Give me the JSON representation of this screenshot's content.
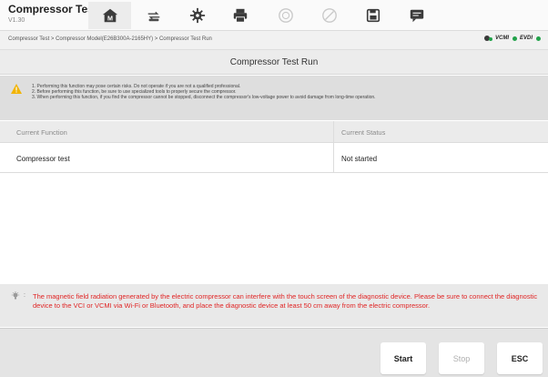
{
  "app": {
    "title": "Compressor Test",
    "version": "V1.30"
  },
  "toolbar": {
    "buttons": [
      {
        "icon": "home-icon",
        "active": true
      },
      {
        "icon": "vehicle-swap-icon",
        "active": false
      },
      {
        "icon": "settings-icon",
        "active": false
      },
      {
        "icon": "printer-icon",
        "active": false
      },
      {
        "icon": "help-icon",
        "active": false,
        "disabled": true
      },
      {
        "icon": "disabled-circle-icon",
        "active": false,
        "disabled": true
      },
      {
        "icon": "save-icon",
        "active": false
      },
      {
        "icon": "message-icon",
        "active": false
      }
    ]
  },
  "breadcrumb": "Compressor Test > Compressor Model(E26B300A-2165HY) > Compressor Test Run",
  "connection": {
    "vcmi": "VCMI",
    "evdi": "EVDI",
    "ok_color": "#22a24a"
  },
  "page": {
    "title": "Compressor Test Run"
  },
  "warning": {
    "lines": [
      "1. Performing this function may pose certain risks. Do not operate if you are not a qualified professional.",
      "2. Before performing this function, be sure to use specialized tools to properly secure the compressor.",
      "3. When performing this function, if you find the compressor cannot be stopped, disconnect the compressor's low-voltage power to avoid damage from long-time operation."
    ]
  },
  "table": {
    "headers": [
      "Current Function",
      "Current Status"
    ],
    "rows": [
      [
        "Compressor test",
        "Not started"
      ]
    ]
  },
  "notice": {
    "text": "The magnetic field radiation generated by the electric compressor can interfere with the touch screen of the diagnostic device. Please be sure to connect the diagnostic device to the VCI or VCMI via Wi-Fi or Bluetooth, and place the diagnostic device at least 50 cm away from the electric compressor.",
    "color": "#e02525"
  },
  "buttons": {
    "start": "Start",
    "stop": "Stop",
    "esc": "ESC"
  }
}
